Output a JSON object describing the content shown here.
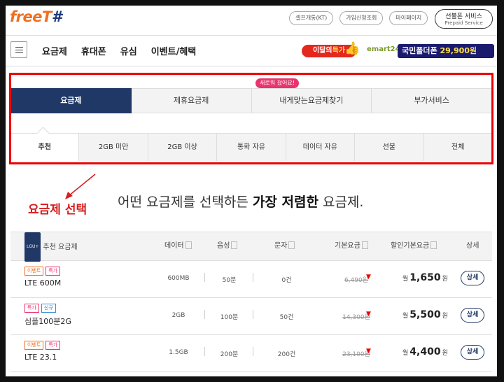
{
  "header": {
    "logo_main": "freeT",
    "logo_suffix": "#",
    "util_links": [
      "셀프개통(KT)",
      "가입신청조회",
      "마이페이지"
    ],
    "prepaid_ko": "선불폰 서비스",
    "prepaid_en": "Prepaid Service"
  },
  "nav": {
    "items": [
      "요금제",
      "휴대폰",
      "유심",
      "이벤트/혜택"
    ]
  },
  "promos": {
    "promo1_a": "이달의",
    "promo1_b": "득가",
    "promo2_brand": "emart24",
    "promo2_a": "국민폴더폰",
    "promo2_b": "29,900원"
  },
  "tabs": {
    "main": [
      "요금제",
      "제휴요금제",
      "내게맞는요금제찾기",
      "부가서비스"
    ],
    "active_main": 0,
    "new_bubble": "새로워 졌어요!",
    "sub": [
      "추천",
      "2GB 미만",
      "2GB 이상",
      "통화 자유",
      "데이터 자유",
      "선불",
      "전체"
    ],
    "active_sub": 0
  },
  "annotation": {
    "label": "요금제 선택"
  },
  "headline": {
    "prefix": "어떤 요금제를 선택하든 ",
    "bold": "가장 저렴한",
    "suffix": " 요금제."
  },
  "table": {
    "brand_badge": "LGU+",
    "headers": {
      "name": "추천 요금제",
      "data": "데이터",
      "voice": "음성",
      "sms": "문자",
      "base": "기본요금",
      "discount": "할인기본요금",
      "detail": "상세"
    },
    "rows": [
      {
        "badges": [
          "이벤트",
          "특가"
        ],
        "name": "LTE 600M",
        "data": "600MB",
        "voice": "50분",
        "sms": "0건",
        "base": "6,490원",
        "disc_prefix": "월",
        "disc": "1,650",
        "disc_unit": "원",
        "detail": "상세"
      },
      {
        "badges": [
          "특가",
          "신규"
        ],
        "name": "심플100분2G",
        "data": "2GB",
        "voice": "100분",
        "sms": "50건",
        "base": "14,300원",
        "disc_prefix": "월",
        "disc": "5,500",
        "disc_unit": "원",
        "detail": "상세"
      },
      {
        "badges": [
          "이벤트",
          "특가"
        ],
        "name": "LTE 23.1",
        "data": "1.5GB",
        "voice": "200분",
        "sms": "200건",
        "base": "23,100원",
        "disc_prefix": "월",
        "disc": "4,400",
        "disc_unit": "원",
        "detail": "상세"
      }
    ]
  },
  "colors": {
    "navy": "#1f3866",
    "orange": "#ef6f1e",
    "annotation_red": "#d61f1f",
    "pink": "#e8356d"
  }
}
